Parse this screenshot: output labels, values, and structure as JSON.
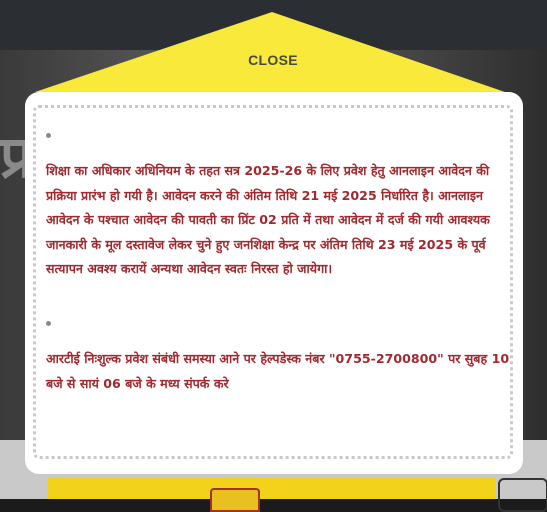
{
  "modal": {
    "close_label": "CLOSE",
    "notices": [
      "शिक्षा का अधिकार अधिनियम के तहत सत्र 2025-26 के लिए प्रवेश हेतु आनलाइन आवेदन की प्रक्रिया प्रारंभ हो गयी है। आवेदन करने की अंतिम तिथि 21 मई 2025 निर्धारित है। आनलाइन आवेदन के पश्चात आवेदन की पावती का प्रिंट 02 प्रति में तथा आवेदन में दर्ज की गयी आवश्यक जानकारी के मूल दस्तावेज लेकर चुने हुए जनशिक्षा केन्द्र पर अंतिम तिथि 23 मई 2025 के पूर्व सत्यापन अवश्य करायें अन्यथा आवेदन स्वतः निरस्त हो जायेगा।",
      "आरटीई निःशुल्क प्रवेश संबंधी समस्या आने पर हेल्पडेस्क नंबर \"0755-2700800\" पर सुबह 10 बजे से सायं 06 बजे के मध्य संपर्क करे"
    ]
  },
  "background": {
    "hero_glyph": "प्र"
  },
  "colors": {
    "accent_yellow": "#f8e93a",
    "notice_text": "#a02a2f",
    "overlay": "#1b1b1b"
  }
}
